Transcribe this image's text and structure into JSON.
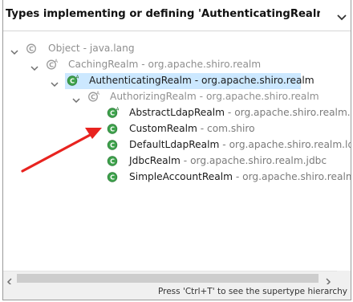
{
  "dialog": {
    "title": "Types implementing or defining 'AuthenticatingRealm.doGetAuthe",
    "status_hint": "Press 'Ctrl+T' to see the supertype hierarchy"
  },
  "tree": {
    "rows": [
      {
        "name": "Object",
        "package": " - java.lang"
      },
      {
        "name": "CachingRealm",
        "package": " - org.apache.shiro.realm"
      },
      {
        "name": "AuthenticatingRealm",
        "package": " - org.apache.shiro.realm"
      },
      {
        "name": "AuthorizingRealm",
        "package": " - org.apache.shiro.realm"
      },
      {
        "name": "AbstractLdapRealm",
        "package": " - org.apache.shiro.realm.lda"
      },
      {
        "name": "CustomRealm",
        "package": " - com.shiro"
      },
      {
        "name": "DefaultLdapRealm",
        "package": " - org.apache.shiro.realm.ldap"
      },
      {
        "name": "JdbcRealm",
        "package": " - org.apache.shiro.realm.jdbc"
      },
      {
        "name": "SimpleAccountRealm",
        "package": " - org.apache.shiro.realm"
      }
    ]
  },
  "colors": {
    "selection": "#cce8ff",
    "class_icon_green": "#3fa34d",
    "annotation_arrow": "#e8231f"
  }
}
